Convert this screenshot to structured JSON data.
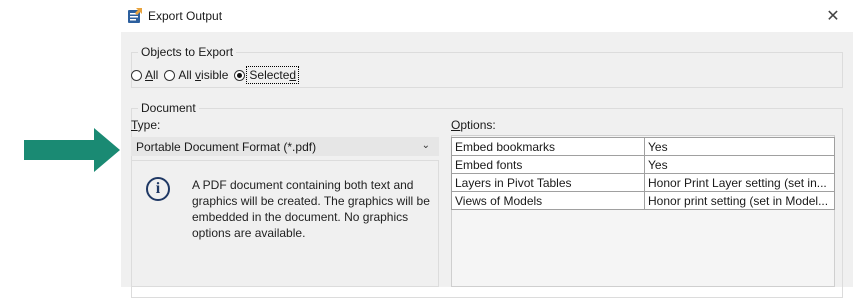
{
  "dialog": {
    "title": "Export Output",
    "close_glyph": "✕"
  },
  "objects": {
    "legend": "Objects to Export",
    "options": [
      {
        "label": "All",
        "mnemonic": "A",
        "rest": "ll",
        "checked": false
      },
      {
        "label": "All visible",
        "prefix": "All ",
        "mnemonic": "v",
        "rest": "isible",
        "checked": false
      },
      {
        "label": "Selected",
        "prefix": "Selecte",
        "mnemonic": "d",
        "rest": "",
        "checked": true
      }
    ]
  },
  "document": {
    "legend": "Document",
    "type_label": {
      "mnemonic": "T",
      "rest": "ype:"
    },
    "type_value": "Portable Document Format (*.pdf)",
    "info_text": "A PDF document containing both text and graphics will be created. The graphics will be embedded in the document. No graphics options are available.",
    "options_label": {
      "mnemonic": "O",
      "rest": "ptions:"
    },
    "options": [
      {
        "name": "Embed bookmarks",
        "value": "Yes"
      },
      {
        "name": "Embed fonts",
        "value": "Yes"
      },
      {
        "name": "Layers in Pivot Tables",
        "value": "Honor Print Layer setting (set in..."
      },
      {
        "name": "Views of Models",
        "value": "Honor print setting (set in Model..."
      }
    ]
  },
  "icons": {
    "app": "export-app-icon",
    "info": "info-icon",
    "arrow": "pointer-arrow",
    "chevron": "chevron-down-icon"
  },
  "colors": {
    "arrow": "#1a8a73",
    "info": "#1f3864"
  }
}
